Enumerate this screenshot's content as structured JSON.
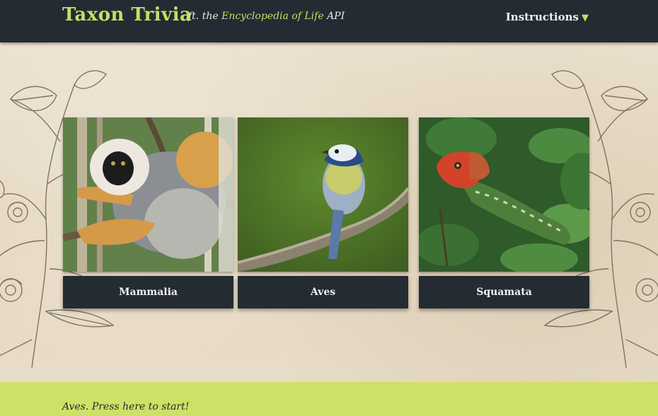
{
  "header": {
    "title": "Taxon Trivia",
    "tagline_prefix": "ft. the ",
    "tagline_source": "Encyclopedia of Life",
    "tagline_suffix": " API",
    "instructions_label": "Instructions",
    "instructions_caret": "▼"
  },
  "cards": [
    {
      "label": "Mammalia",
      "image": "lemur-photo"
    },
    {
      "label": "Aves",
      "image": "bird-photo"
    },
    {
      "label": "Squamata",
      "image": "lizard-photo"
    }
  ],
  "footer": {
    "prompt": "Aves. Press here to start!"
  },
  "colors": {
    "header_bg": "#242b33",
    "accent": "#c7de5f",
    "footer_bg": "#cfe066",
    "paper": "#e7dbc6"
  }
}
